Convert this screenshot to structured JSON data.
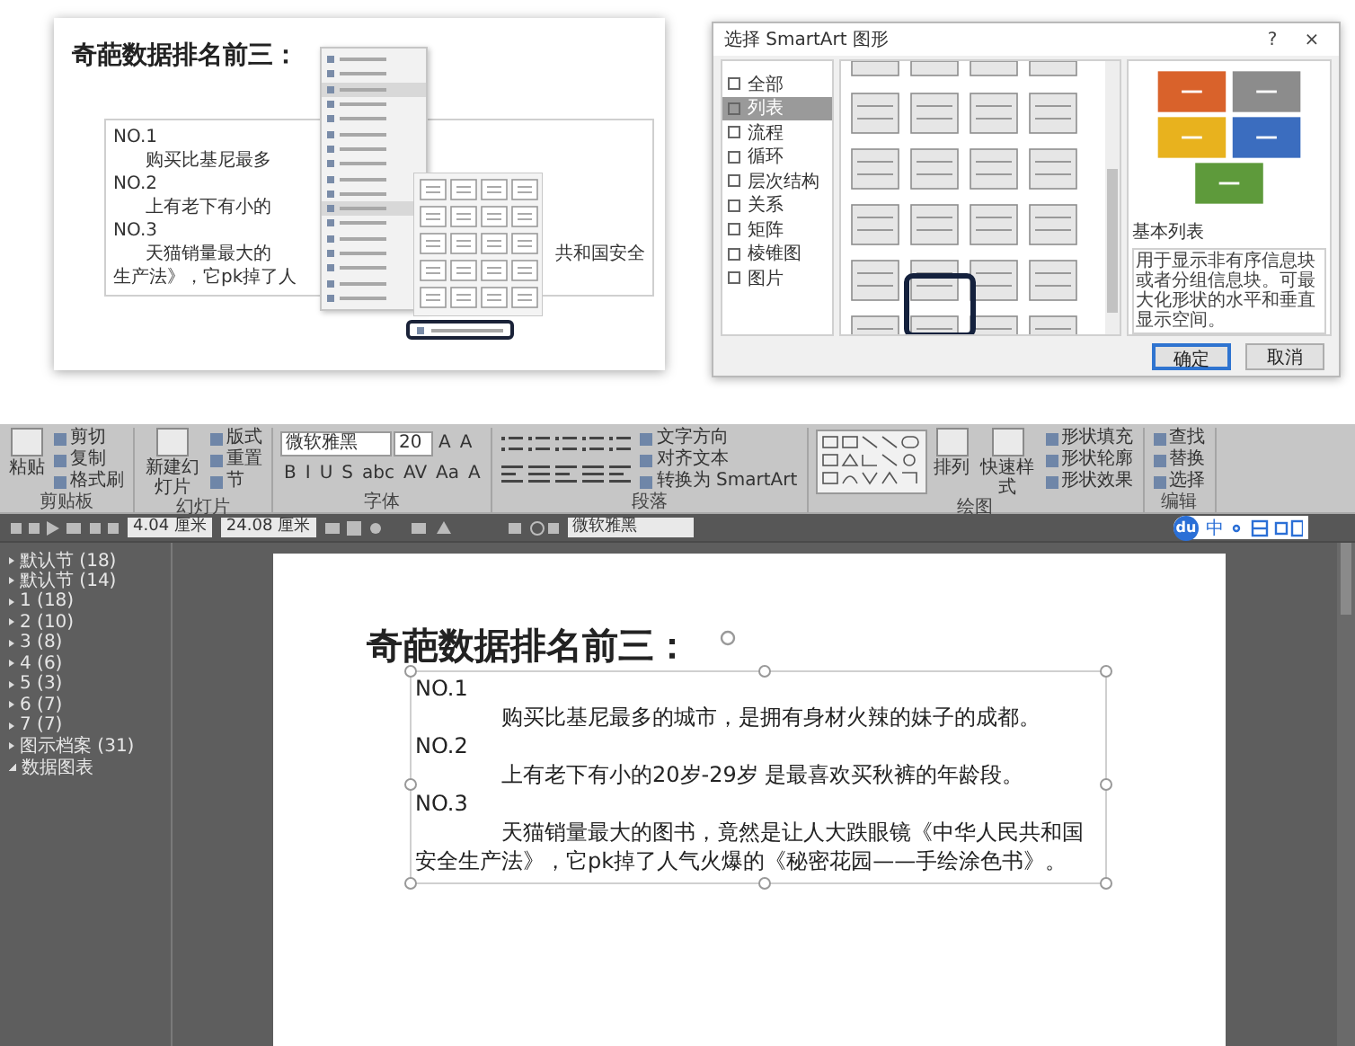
{
  "card": {
    "title": "奇葩数据排名前三：",
    "lines": [
      {
        "kind": "label",
        "text": "NO.1"
      },
      {
        "kind": "body",
        "text": "购买比基尼最多"
      },
      {
        "kind": "label",
        "text": "NO.2"
      },
      {
        "kind": "body",
        "text": "上有老下有小的"
      },
      {
        "kind": "label",
        "text": "NO.3"
      },
      {
        "kind": "body",
        "text": "天猫销量最大的",
        "tail": "共和国安全"
      },
      {
        "kind": "cont",
        "text": "生产法》，它pk掉了人"
      }
    ]
  },
  "dialog": {
    "title": "选择 SmartArt 图形",
    "help": "?",
    "close": "×",
    "categories": [
      {
        "label": "全部",
        "selected": false
      },
      {
        "label": "列表",
        "selected": true
      },
      {
        "label": "流程",
        "selected": false
      },
      {
        "label": "循环",
        "selected": false
      },
      {
        "label": "层次结构",
        "selected": false
      },
      {
        "label": "关系",
        "selected": false
      },
      {
        "label": "矩阵",
        "selected": false
      },
      {
        "label": "棱锥图",
        "selected": false
      },
      {
        "label": "图片",
        "selected": false
      }
    ],
    "layout_name": "基本列表",
    "description": "用于显示非有序信息块或者分组信息块。可最大化形状的水平和垂直显示空间。",
    "buttons": [
      {
        "label": "确定",
        "default": true
      },
      {
        "label": "取消",
        "default": false
      }
    ]
  },
  "editor": {
    "ribbon": [
      {
        "kind": "clipboard",
        "label": "剪贴板",
        "big": [
          "粘贴"
        ],
        "small": [
          "剪切",
          "复制",
          "格式刷"
        ]
      },
      {
        "kind": "slides",
        "label": "幻灯片",
        "big": [
          "新建幻灯片"
        ],
        "small": [
          "版式",
          "重置",
          "节"
        ]
      },
      {
        "kind": "font",
        "label": "字体",
        "font": "微软雅黑",
        "size": "20",
        "row1": [
          "A",
          "A"
        ],
        "row2": [
          "B",
          "I",
          "U",
          "S",
          "abc",
          "AV",
          "Aa",
          "A"
        ]
      },
      {
        "kind": "paragraph",
        "label": "段落",
        "small": [
          "文字方向",
          "对齐文本",
          "转换为 SmartArt"
        ]
      },
      {
        "kind": "drawing",
        "label": "绘图",
        "big": [
          "排列",
          "快速样式"
        ],
        "small": [
          "形状填充",
          "形状轮廓",
          "形状效果"
        ]
      },
      {
        "kind": "editing",
        "label": "编辑",
        "small": [
          "查找",
          "替换",
          "选择"
        ]
      }
    ],
    "format_bar": {
      "height": "4.04 厘米",
      "width": "24.08 厘米",
      "font": "微软雅黑"
    },
    "ime": {
      "logo": "du",
      "mode": "中"
    },
    "sections": [
      {
        "label": "默认节 (18)",
        "expanded": false
      },
      {
        "label": "默认节 (14)",
        "expanded": false
      },
      {
        "label": "1 (18)",
        "expanded": false
      },
      {
        "label": "2 (10)",
        "expanded": false
      },
      {
        "label": "3 (8)",
        "expanded": false
      },
      {
        "label": "4 (6)",
        "expanded": false
      },
      {
        "label": "5 (3)",
        "expanded": false
      },
      {
        "label": "6 (7)",
        "expanded": false
      },
      {
        "label": "7 (7)",
        "expanded": false
      },
      {
        "label": "图示档案 (31)",
        "expanded": false
      },
      {
        "label": "数据图表",
        "expanded": true
      }
    ],
    "slide": {
      "title": "奇葩数据排名前三：",
      "paragraphs": [
        {
          "kind": "label",
          "text": "NO.1"
        },
        {
          "kind": "body",
          "text": "购买比基尼最多的城市，是拥有身材火辣的妹子的成都。"
        },
        {
          "kind": "label",
          "text": "NO.2"
        },
        {
          "kind": "body",
          "text": "上有老下有小的20岁-29岁 是最喜欢买秋裤的年龄段。"
        },
        {
          "kind": "label",
          "text": "NO.3"
        },
        {
          "kind": "body",
          "text": "天猫销量最大的图书，竟然是让人大跌眼镜《中华人民共和国安全生产法》，它pk掉了人气火爆的《秘密花园——手绘涂色书》。"
        }
      ]
    }
  }
}
